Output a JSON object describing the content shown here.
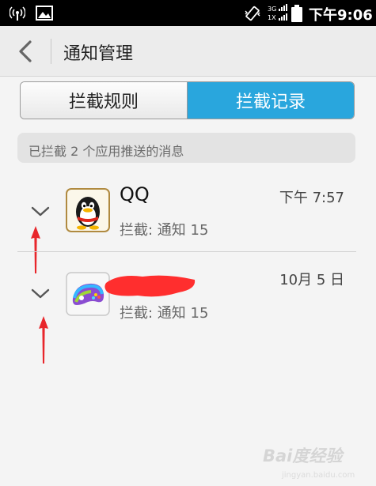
{
  "status_bar": {
    "time": "下午9:06",
    "network_label_top": "3G",
    "network_label_bottom": "1X",
    "icons": [
      "wireless-signal-icon",
      "image-icon",
      "vibrate-icon",
      "network-signal-icon",
      "battery-icon"
    ]
  },
  "header": {
    "title": "通知管理",
    "back_icon": "chevron-left-icon"
  },
  "tabs": [
    {
      "label": "拦截规则",
      "selected": false
    },
    {
      "label": "拦截记录",
      "selected": true
    }
  ],
  "summary": "已拦截 2 个应用推送的消息",
  "items": [
    {
      "name": "QQ",
      "sub": "拦截: 通知 15",
      "date": "下午 7:57",
      "icon": "qq-penguin-icon"
    },
    {
      "name": "",
      "sub": "拦截: 通知 15",
      "date": "10月 5 日",
      "icon": "game-center-icon"
    }
  ],
  "watermark": {
    "text": "Bai度经验",
    "sub": "jingyan.baidu.com"
  },
  "colors": {
    "accent": "#29a6dd",
    "annotation": "#e8262b",
    "status_bg": "#000000"
  }
}
